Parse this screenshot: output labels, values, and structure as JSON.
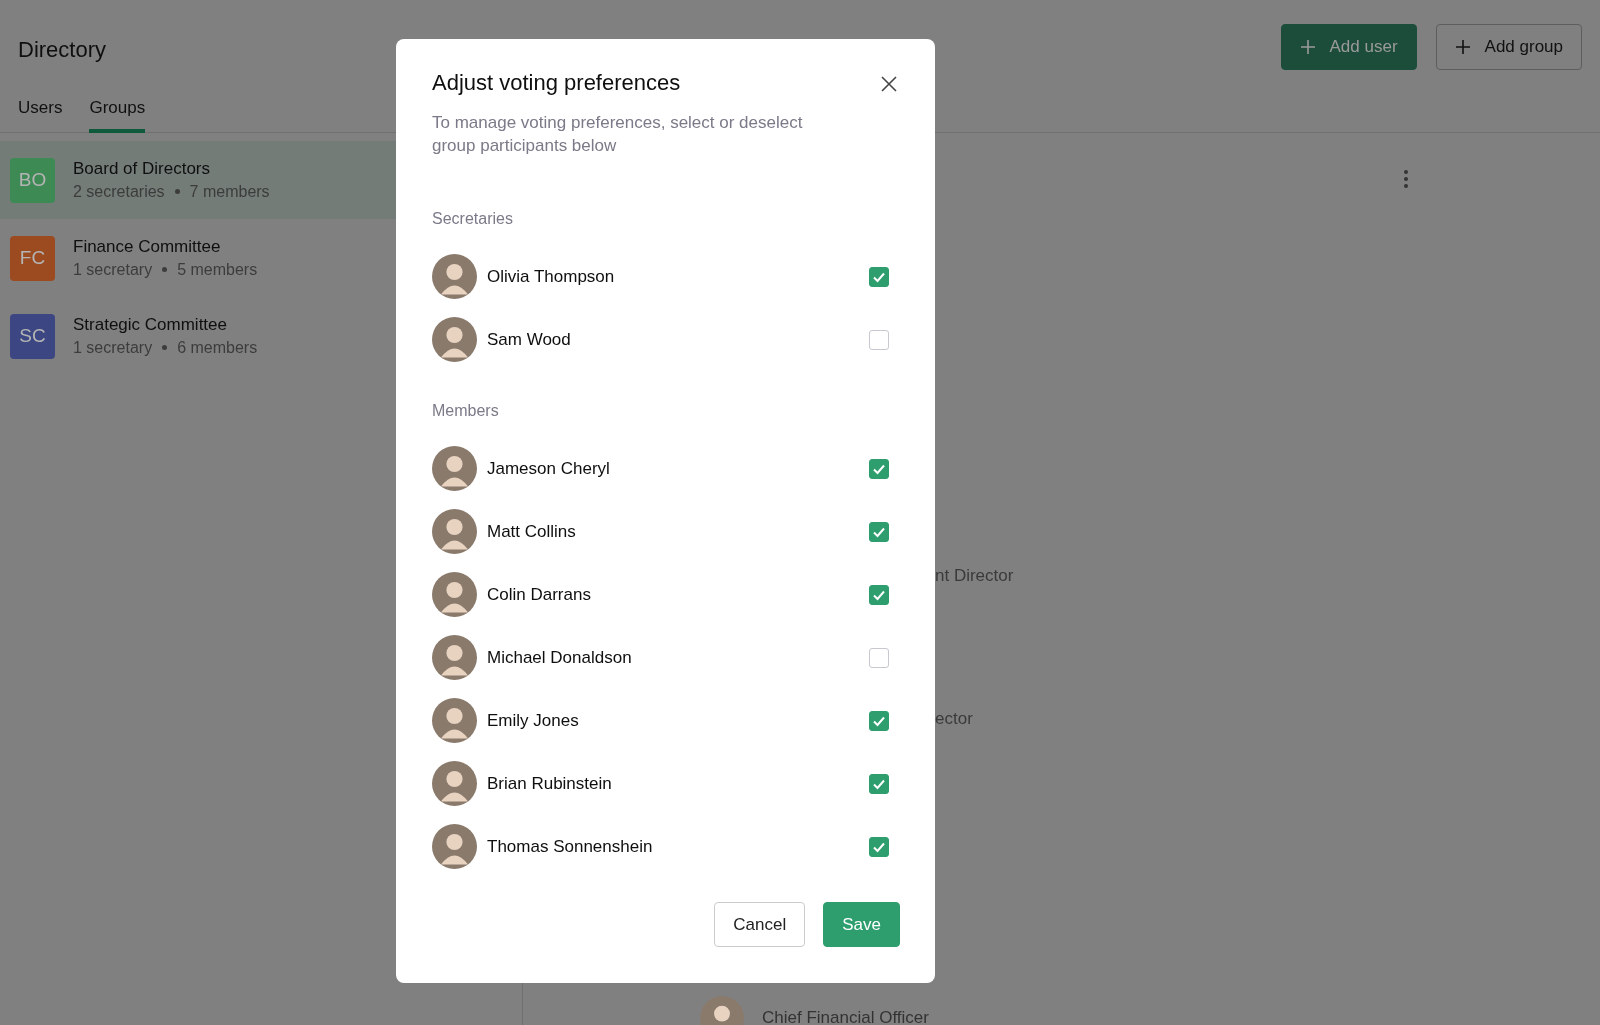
{
  "header": {
    "title": "Directory",
    "buttons": [
      {
        "label": "Add user",
        "kind": "primary"
      },
      {
        "label": "Add group",
        "kind": "outline"
      }
    ]
  },
  "tabs": [
    {
      "label": "Users",
      "selected": false
    },
    {
      "label": "Groups",
      "selected": true
    }
  ],
  "groups": [
    {
      "initials": "BO",
      "name": "Board of Directors",
      "secretaries": "2 secretaries",
      "members": "7 members",
      "color": "#3d8a55",
      "selected": true
    },
    {
      "initials": "FC",
      "name": "Finance Committee",
      "secretaries": "1 secretary",
      "members": "5 members",
      "color": "#9c4a1f",
      "selected": false
    },
    {
      "initials": "SC",
      "name": "Strategic Committee",
      "secretaries": "1 secretary",
      "members": "6 members",
      "color": "#3b4682",
      "selected": false
    }
  ],
  "detail": {
    "fragments": [
      "nt Director",
      "ector"
    ],
    "person": {
      "title": "Chief Financial Officer"
    }
  },
  "modal": {
    "title": "Adjust voting preferences",
    "subtitle": "To manage voting preferences, select or deselect group participants below",
    "sections": [
      {
        "title": "Secretaries",
        "people": [
          {
            "name": "Olivia Thompson",
            "checked": true
          },
          {
            "name": "Sam Wood",
            "checked": false
          }
        ]
      },
      {
        "title": "Members",
        "people": [
          {
            "name": "Jameson Cheryl",
            "checked": true
          },
          {
            "name": "Matt Collins",
            "checked": true
          },
          {
            "name": "Colin Darrans",
            "checked": true
          },
          {
            "name": "Michael Donaldson",
            "checked": false
          },
          {
            "name": "Emily Jones",
            "checked": true
          },
          {
            "name": "Brian Rubinstein",
            "checked": true
          },
          {
            "name": "Thomas Sonnenshein",
            "checked": true
          }
        ]
      }
    ],
    "buttons": [
      {
        "label": "Cancel",
        "kind": "outline"
      },
      {
        "label": "Save",
        "kind": "primary"
      }
    ]
  }
}
